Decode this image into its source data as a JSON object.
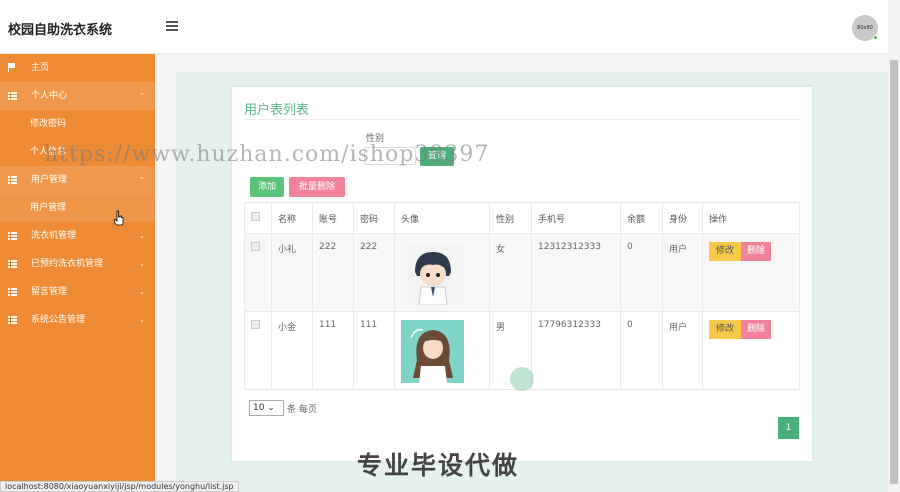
{
  "header": {
    "brand": "校园自助洗衣系统",
    "avatar_text": "80x80"
  },
  "sidebar": {
    "items": [
      {
        "label": "主页",
        "icon": "flag-icon"
      },
      {
        "label": "个人中心",
        "icon": "grid-icon",
        "caret": "⌃",
        "children": [
          "修改密码",
          "个人信息"
        ]
      },
      {
        "label": "用户管理",
        "icon": "grid-icon",
        "caret": "⌃",
        "children": [
          "用户管理"
        ]
      },
      {
        "label": "洗衣机管理",
        "icon": "grid-icon",
        "caret": "⌄"
      },
      {
        "label": "已预约洗衣机管理",
        "icon": "grid-icon",
        "caret": "⌄"
      },
      {
        "label": "留言管理",
        "icon": "grid-icon",
        "caret": "⌄"
      },
      {
        "label": "系统公告管理",
        "icon": "grid-icon",
        "caret": "⌄"
      }
    ]
  },
  "main": {
    "title": "用户表列表",
    "filter": {
      "label": "性别",
      "search_label": "查询"
    },
    "buttons": {
      "add": "添加",
      "batch_delete": "批量删除"
    },
    "table": {
      "headers": [
        "名称",
        "账号",
        "密码",
        "头像",
        "性别",
        "手机号",
        "余额",
        "身份",
        "操作"
      ],
      "rows": [
        {
          "name": "小礼",
          "account": "222",
          "password": "222",
          "gender": "女",
          "phone": "12312312333",
          "balance": "0",
          "role": "用户"
        },
        {
          "name": "小金",
          "account": "111",
          "password": "111",
          "gender": "男",
          "phone": "17796312333",
          "balance": "0",
          "role": "用户"
        }
      ],
      "edit_label": "修改",
      "delete_label": "删除"
    },
    "pagination": {
      "page_size": "10",
      "page_size_label": "条 每页",
      "current_page": "1"
    }
  },
  "overlays": {
    "watermark": "https://www.huzhan.com/ishop39397",
    "promo": "专业毕设代做"
  },
  "status_bar": {
    "url": "localhost:8080/xiaoyuanxiyiji/jsp/modules/yonghu/list.jsp"
  },
  "colors": {
    "sidebar": "#ee8a33",
    "accent": "#4caf7a",
    "danger": "#f08399",
    "warning": "#f7c948"
  }
}
